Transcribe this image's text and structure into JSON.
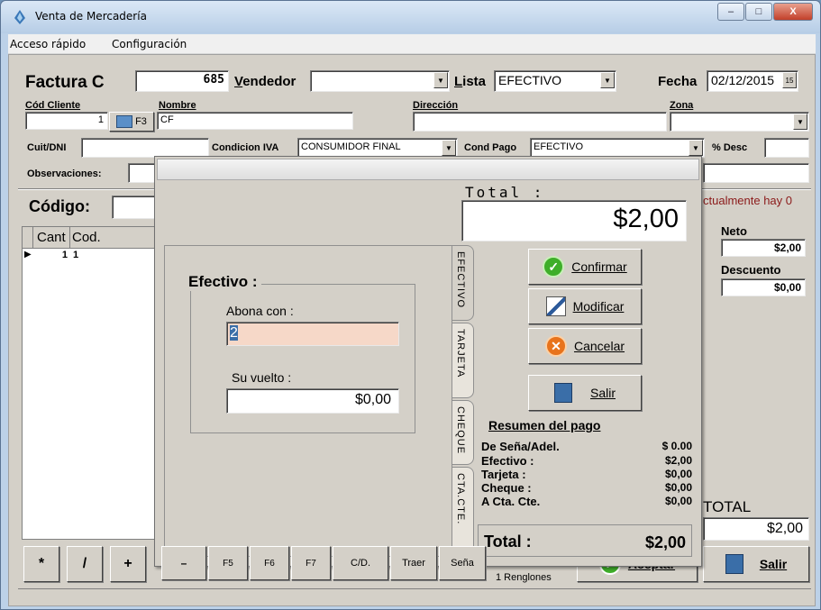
{
  "window": {
    "title": "Venta de Mercadería",
    "min": "–",
    "max": "□",
    "close": "X"
  },
  "menu": {
    "items": [
      "Acceso rápido",
      "Configuración"
    ]
  },
  "header": {
    "factura_label": "Factura C",
    "factura_num": "685",
    "vendedor_label": "Vendedor",
    "vendedor_value": "",
    "lista_label": "Lista",
    "lista_value": "EFECTIVO",
    "fecha_label": "Fecha",
    "fecha_value": "02/12/2015",
    "cal_icon_text": "15"
  },
  "client": {
    "cod_cliente_label": "Cód Cliente",
    "cod_cliente_value": "1",
    "f3_label": "F3",
    "nombre_label": "Nombre",
    "nombre_value": "CF",
    "direccion_label": "Dirección",
    "direccion_value": "",
    "zona_label": "Zona",
    "zona_value": "",
    "cuit_label": "Cuit/DNI",
    "cuit_value": "",
    "cond_iva_label": "Condicion IVA",
    "cond_iva_value": "CONSUMIDOR FINAL",
    "cond_pago_label": "Cond Pago",
    "cond_pago_value": "EFECTIVO",
    "desc_label": "% Desc",
    "desc_value": "",
    "obs_label": "Observaciones:",
    "obs_value": ""
  },
  "codigo": {
    "label": "Código:",
    "value": ""
  },
  "grid": {
    "headers": [
      "Cant",
      "Cod."
    ],
    "rows": [
      {
        "cant": "1",
        "cod": "1"
      }
    ]
  },
  "right_panel": {
    "stock_msg": "ctualmente hay 0",
    "neto_label": "Neto",
    "neto_value": "$2,00",
    "descuento_label": "Descuento",
    "descuento_value": "$0,00",
    "total_label": "TOTAL",
    "total_value": "$2,00",
    "salir_label": "Salir",
    "aceptar_label": "Aceptar",
    "renglones": "1 Renglones"
  },
  "bottom_buttons": [
    "*",
    "/",
    "+",
    "–",
    "F5",
    "F6",
    "F7",
    "C/D.",
    "Traer",
    "Seña"
  ],
  "payment_dialog": {
    "total_label": "Total :",
    "total_amount": "$2,00",
    "tabs": [
      "EFECTIVO",
      "TARJETA",
      "CHEQUE",
      "CTA.CTE."
    ],
    "efectivo_title": "Efectivo :",
    "abona_label": "Abona con :",
    "abona_value": "2",
    "vuelto_label": "Su vuelto :",
    "vuelto_value": "$0,00",
    "buttons": {
      "confirmar": "Confirmar",
      "modificar": "Modificar",
      "cancelar": "Cancelar",
      "salir": "Salir"
    },
    "resumen_title": "Resumen del pago",
    "resumen": [
      {
        "label": "De Seña/Adel.",
        "value": "$ 0.00"
      },
      {
        "label": "Efectivo :",
        "value": "$2,00"
      },
      {
        "label": "Tarjeta :",
        "value": "$0,00"
      },
      {
        "label": "Cheque :",
        "value": "$0,00"
      },
      {
        "label": "A Cta. Cte.",
        "value": "$0,00"
      }
    ],
    "final_total_label": "Total :",
    "final_total_value": "$2,00"
  },
  "colors": {
    "accent_red": "#8b1a1a",
    "titlebar": "#bcd1e8",
    "form_bg": "#d4d0c8",
    "abona_bg": "#f6d8c8"
  }
}
